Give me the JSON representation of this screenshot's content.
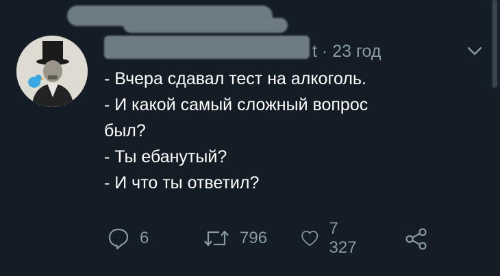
{
  "tweet": {
    "handle_fragment": "t",
    "separator": "·",
    "time_ago": "23 год",
    "lines": [
      "- Вчера сдавал тест на алкоголь.",
      "- И какой самый сложный вопрос",
      "был?",
      "- Ты ебанутый?",
      "- И что ты ответил?"
    ]
  },
  "actions": {
    "reply_count": "6",
    "retweet_count": "796",
    "like_count": "7 327"
  },
  "icons": {
    "reply": "reply-icon",
    "retweet": "retweet-icon",
    "like": "heart-icon",
    "share": "share-icon",
    "menu": "chevron-down-icon"
  },
  "colors": {
    "background": "#141d26",
    "text": "#ffffff",
    "muted": "#8899a6",
    "redaction": "#6d7b82"
  }
}
